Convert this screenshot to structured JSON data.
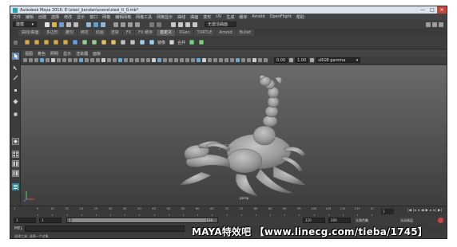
{
  "window": {
    "title": "Autodesk Maya 2016: E:\\xiexi_jiandan\\scene\\xiezi_ti_0.mb*",
    "buttons": [
      "—",
      "□",
      "✕"
    ]
  },
  "menubar": [
    "文件",
    "编辑",
    "创建",
    "选择",
    "修改",
    "显示",
    "窗口",
    "网格",
    "编辑网格",
    "网格工具",
    "网格显示",
    "曲线",
    "曲面",
    "变形",
    "UV",
    "生成",
    "缓存",
    "Arnold",
    "OpenFlight",
    "帮助"
  ],
  "status_line": {
    "mode_dropdown": "建模",
    "renderer_label": "无激活曲面",
    "icons": [
      "new-scene-icon",
      "open-scene-icon",
      "save-scene-icon",
      "undo-icon",
      "redo-icon",
      "select-hierarchy-icon",
      "select-object-icon",
      "select-component-icon",
      "snap-grid-icon",
      "snap-curve-icon",
      "snap-point-icon",
      "render-icon",
      "ipr-render-icon",
      "render-settings-icon"
    ]
  },
  "shelf_tabs": [
    "曲线/曲面",
    "多边形",
    "雕刻",
    "绑定",
    "动画",
    "渲染",
    "FX",
    "FX 缓存",
    "自定义",
    "XGen",
    "TURTLE",
    "Arnold",
    "Bullet"
  ],
  "shelf_active_tab": "自定义",
  "shelf_icons": [
    "poly-cube-icon",
    "poly-sphere-icon",
    "poly-cylinder-icon",
    "poly-plane-icon",
    "poly-torus-icon",
    "nurbs-circle-icon",
    "combine-icon",
    "separate-icon",
    "extrude-icon",
    "bridge-icon",
    "bevel-icon",
    "merge-icon",
    "mirror-icon",
    "smooth-icon",
    "center-pivot-icon",
    "freeze-icon",
    "delete-history-icon"
  ],
  "shelf_labels": {
    "a": "镜像",
    "b": "合并"
  },
  "panel_menu": [
    "视图",
    "着色",
    "照明",
    "显示",
    "渲染器",
    "面板"
  ],
  "panel_toolbar": {
    "field_a": "0.00",
    "field_b": "1.00",
    "colorspace": "sRGB gamma"
  },
  "viewport": {
    "camera_label": "persp"
  },
  "timeline": {
    "ticks": [
      "5",
      "10",
      "15",
      "20",
      "25",
      "30",
      "35",
      "40",
      "45",
      "50",
      "55",
      "60",
      "65",
      "70",
      "75",
      "80",
      "85",
      "90",
      "95",
      "100",
      "105",
      "110",
      "115",
      "12"
    ],
    "start_tick": "1",
    "current_frame": "1"
  },
  "range": {
    "start": "1",
    "playback_start": "1",
    "slider_start": "1",
    "slider_end": "120",
    "playback_end": "120",
    "end": "200",
    "char_set": "无角色集",
    "anim_layer": "无动画层",
    "slider_fill_percent": 96
  },
  "command_line": {
    "label": "MEL"
  },
  "help_line": "选择工具: 选择一个对象",
  "watermark": "MAYA特效吧 【www.linecg.com/tieba/1745】",
  "colors": {
    "accent": "#2aa0b5",
    "active_tab": "#5b5b5b",
    "viewport_top": "#6a6a6a",
    "viewport_bottom": "#3e3e3e",
    "close_button": "#c9463d"
  }
}
